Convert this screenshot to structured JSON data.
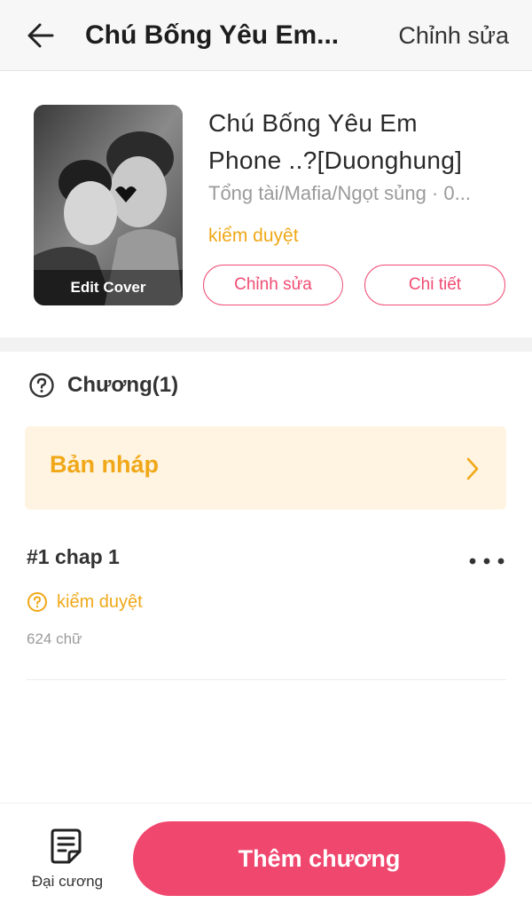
{
  "header": {
    "back_icon": "arrow-left-icon",
    "title": "Chú Bống Yêu Em...",
    "edit_label": "Chỉnh sửa"
  },
  "story": {
    "cover_label": "Edit Cover",
    "title_line1": "Chú Bống Yêu Em",
    "title_line2": "Phone ..?[Duonghung]",
    "genre": "Tổng tài/Mafia/Ngọt sủng · 0...",
    "status": "kiểm duyệt",
    "edit_button": "Chỉnh sửa",
    "detail_button": "Chi tiết"
  },
  "chapters": {
    "header_icon": "question-circle-icon",
    "header_label": "Chương(1)",
    "draft_label": "Bản nháp",
    "draft_icon": "chevron-right-icon",
    "items": [
      {
        "title": "#1 chap 1",
        "status_icon": "question-circle-icon",
        "status": "kiểm duyệt",
        "words": "624 chữ",
        "more_icon": "more-horizontal-icon"
      }
    ]
  },
  "bottom_bar": {
    "outline_icon": "document-icon",
    "outline_label": "Đại cương",
    "add_chapter_label": "Thêm chương"
  },
  "colors": {
    "accent": "#f0476f",
    "warning": "#f0a818",
    "draft_bg": "#fff4e2"
  }
}
